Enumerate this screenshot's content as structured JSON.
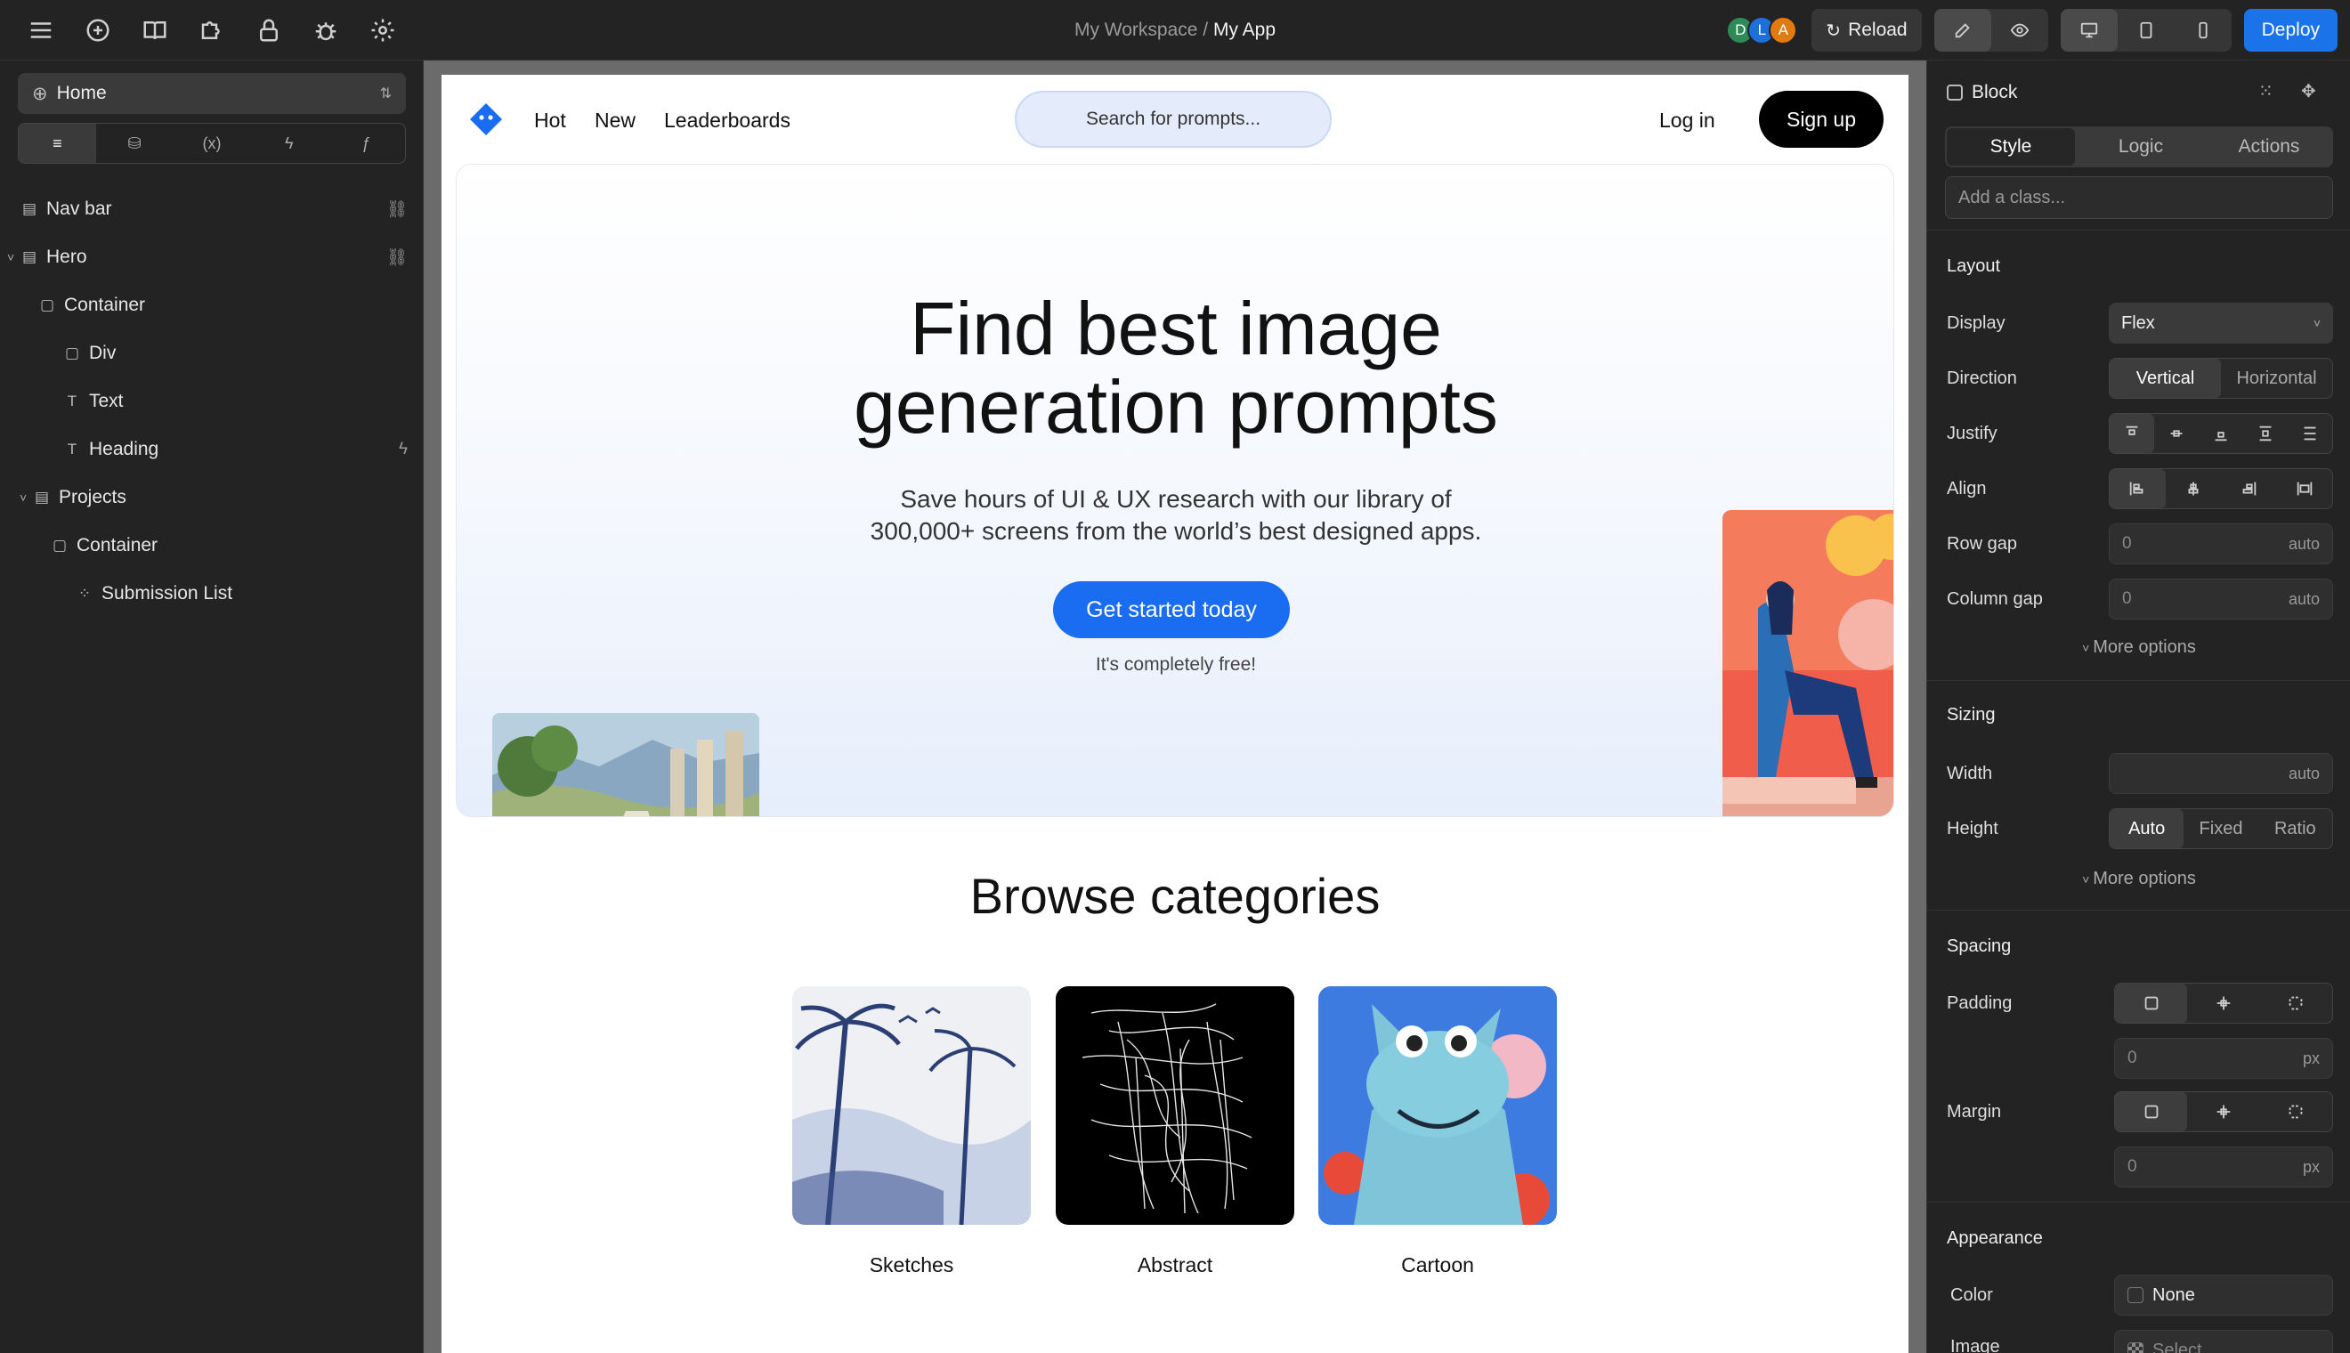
{
  "toolbar": {
    "left_icons": [
      "menu-icon",
      "plus-circle-icon",
      "book-icon",
      "puzzle-icon",
      "lock-icon",
      "bug-icon",
      "gear-icon"
    ],
    "breadcrumb_workspace": "My Workspace",
    "breadcrumb_separator": "/",
    "breadcrumb_app": "My App",
    "avatars": [
      {
        "letter": "D",
        "color": "#2e8b57"
      },
      {
        "letter": "L",
        "color": "#1e6fd9"
      },
      {
        "letter": "A",
        "color": "#e07b12"
      }
    ],
    "reload_label": "Reload",
    "deploy_label": "Deploy"
  },
  "left_panel": {
    "page_select": "Home",
    "tabs": [
      "layers-tab",
      "database-tab",
      "variables-tab",
      "actions-tab",
      "functions-tab"
    ],
    "tab_glyphs": [
      "≡",
      "⛁",
      "(x)",
      "ϟ",
      "ƒ"
    ],
    "tree": [
      {
        "label": "Nav bar",
        "depth": 0,
        "caret": "",
        "icon": "▤",
        "right": "🔗"
      },
      {
        "label": "Hero",
        "depth": 0,
        "caret": "˅",
        "icon": "▤",
        "right": "🔗"
      },
      {
        "label": "Container",
        "depth": 1,
        "caret": "",
        "icon": "▢",
        "right": ""
      },
      {
        "label": "Div",
        "depth": 2,
        "caret": "",
        "icon": "▢",
        "right": ""
      },
      {
        "label": "Text",
        "depth": 2,
        "caret": "",
        "icon": "T",
        "right": ""
      },
      {
        "label": "Heading",
        "depth": 2,
        "caret": "",
        "icon": "T",
        "right": "ϟ"
      },
      {
        "label": "Projects",
        "depth": 0,
        "caret": "˅",
        "icon": "▤",
        "right": ""
      },
      {
        "label": "Container",
        "depth": 1,
        "caret": "",
        "icon": "▢",
        "right": ""
      },
      {
        "label": "Submission List",
        "depth": 2,
        "caret": "",
        "icon": "⁘",
        "right": ""
      }
    ]
  },
  "site": {
    "nav_links": [
      "Hot",
      "New",
      "Leaderboards"
    ],
    "search_placeholder": "Search for prompts...",
    "login": "Log in",
    "signup": "Sign up",
    "hero_title_line1": "Find best image",
    "hero_title_line2": "generation prompts",
    "hero_sub_line1": "Save hours of UI & UX research with our library of",
    "hero_sub_line2": "300,000+ screens from the world’s best designed apps.",
    "cta": "Get started today",
    "free_note": "It's completely free!",
    "browse_title": "Browse categories",
    "categories": [
      "Sketches",
      "Abstract",
      "Cartoon"
    ],
    "brand_color": "#1a6df0"
  },
  "right_panel": {
    "element_label": "Block",
    "tabs": [
      "Style",
      "Logic",
      "Actions"
    ],
    "class_placeholder": "Add a class...",
    "layout_title": "Layout",
    "display_label": "Display",
    "display_value": "Flex",
    "direction_label": "Direction",
    "direction_options": [
      "Vertical",
      "Horizontal"
    ],
    "justify_label": "Justify",
    "align_label": "Align",
    "row_gap_label": "Row gap",
    "row_gap_value": "0",
    "row_gap_unit": "auto",
    "column_gap_label": "Column gap",
    "column_gap_value": "0",
    "column_gap_unit": "auto",
    "more_options": "More options",
    "sizing_title": "Sizing",
    "width_label": "Width",
    "width_unit": "auto",
    "height_label": "Height",
    "height_options": [
      "Auto",
      "Fixed",
      "Ratio"
    ],
    "spacing_title": "Spacing",
    "padding_label": "Padding",
    "padding_value": "0",
    "padding_unit": "px",
    "margin_label": "Margin",
    "margin_value": "0",
    "margin_unit": "px",
    "appearance_title": "Appearance",
    "color_label": "Color",
    "color_value": "None",
    "image_label": "Image",
    "image_value": "Select"
  }
}
